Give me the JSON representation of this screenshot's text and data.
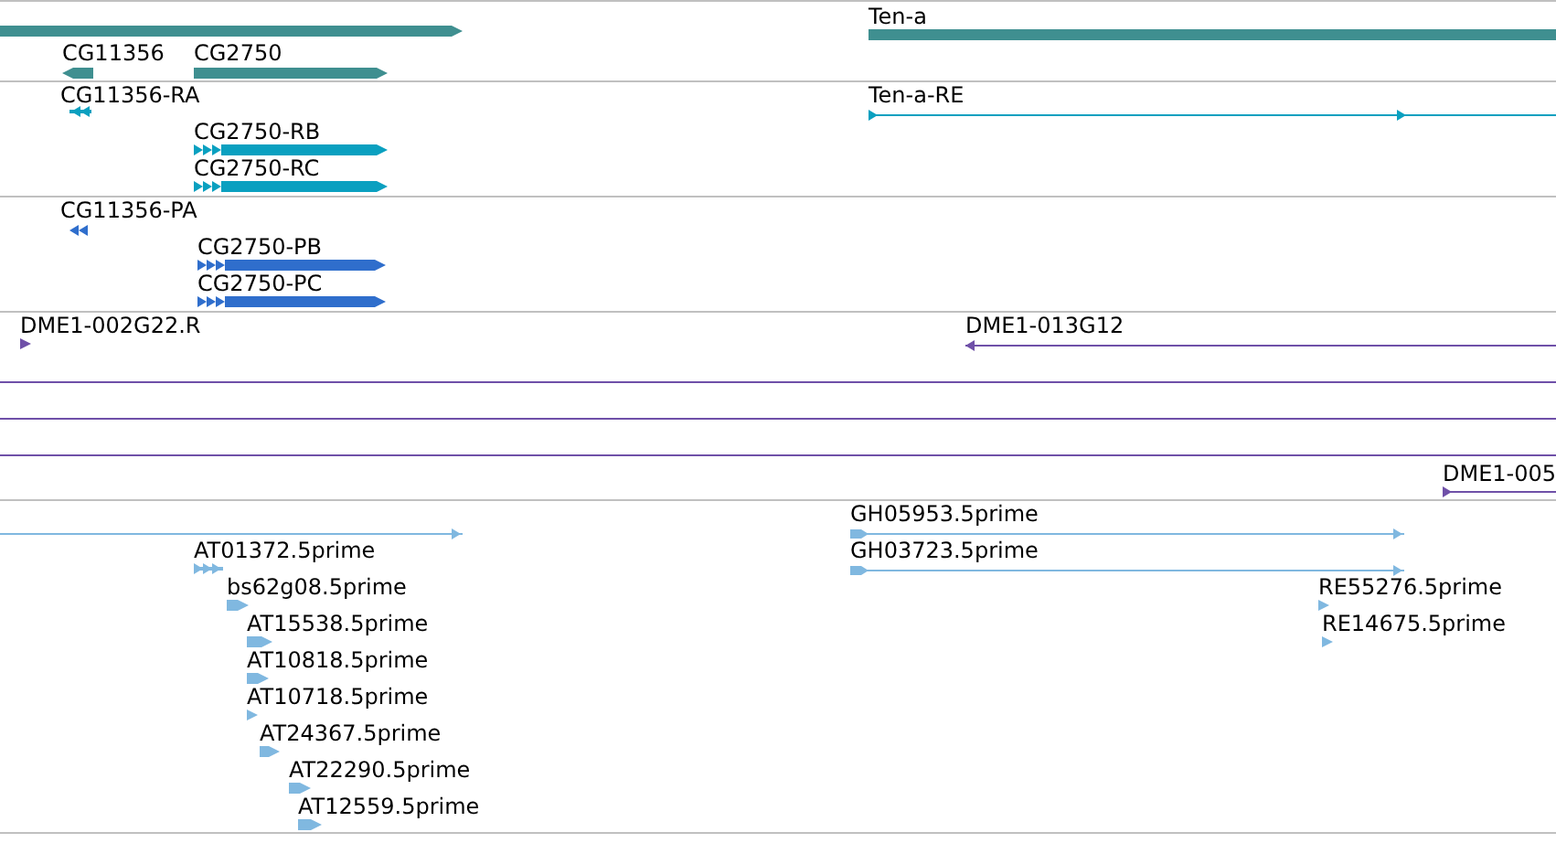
{
  "tracks": [
    {
      "color": "#3f8f90",
      "features": [
        {
          "kind": "bar",
          "reverse": false
        },
        {
          "kind": "bar",
          "reverse": true,
          "label": "CG11356"
        },
        {
          "kind": "bar",
          "reverse": false,
          "label": "CG2750"
        },
        {
          "kind": "bar",
          "label": "Ten-a"
        }
      ]
    },
    {
      "color": "#0aa0c0",
      "features": [
        {
          "kind": "exons",
          "reverse": true,
          "label": "CG11356-RA"
        },
        {
          "kind": "exons",
          "reverse": false,
          "label": "CG2750-RB"
        },
        {
          "kind": "exons",
          "reverse": false,
          "label": "CG2750-RC"
        },
        {
          "kind": "line",
          "reverse": false,
          "label": "Ten-a-RE"
        }
      ]
    },
    {
      "color": "#2f6ecc",
      "features": [
        {
          "kind": "exons",
          "reverse": true,
          "label": "CG11356-PA"
        },
        {
          "kind": "exons",
          "reverse": false,
          "label": "CG2750-PB"
        },
        {
          "kind": "exons",
          "reverse": false,
          "label": "CG2750-PC"
        }
      ]
    },
    {
      "color": "#6f50a8",
      "features": [
        {
          "kind": "bar",
          "reverse": false,
          "label": "DME1-002G22.R"
        },
        {
          "kind": "line",
          "reverse": true,
          "label": "DME1-013G12"
        },
        {
          "kind": "line"
        },
        {
          "kind": "line"
        },
        {
          "kind": "line"
        },
        {
          "kind": "line",
          "reverse": false,
          "label": "DME1-005"
        }
      ]
    },
    {
      "color": "#80b8e0",
      "features": [
        {
          "kind": "line",
          "reverse": false
        },
        {
          "kind": "exons",
          "reverse": false,
          "label": "AT01372.5prime"
        },
        {
          "kind": "bar",
          "reverse": false,
          "label": "bs62g08.5prime"
        },
        {
          "kind": "bar",
          "reverse": false,
          "label": "AT15538.5prime"
        },
        {
          "kind": "bar",
          "reverse": false,
          "label": "AT10818.5prime"
        },
        {
          "kind": "bar",
          "reverse": false,
          "label": "AT10718.5prime"
        },
        {
          "kind": "bar",
          "reverse": false,
          "label": "AT24367.5prime"
        },
        {
          "kind": "bar",
          "reverse": false,
          "label": "AT22290.5prime"
        },
        {
          "kind": "bar",
          "reverse": false,
          "label": "AT12559.5prime"
        },
        {
          "kind": "line",
          "reverse": false,
          "label": "GH05953.5prime"
        },
        {
          "kind": "line",
          "reverse": false,
          "label": "GH03723.5prime"
        },
        {
          "kind": "bar",
          "reverse": false,
          "label": "RE55276.5prime"
        },
        {
          "kind": "bar",
          "reverse": false,
          "label": "RE14675.5prime"
        }
      ]
    }
  ]
}
